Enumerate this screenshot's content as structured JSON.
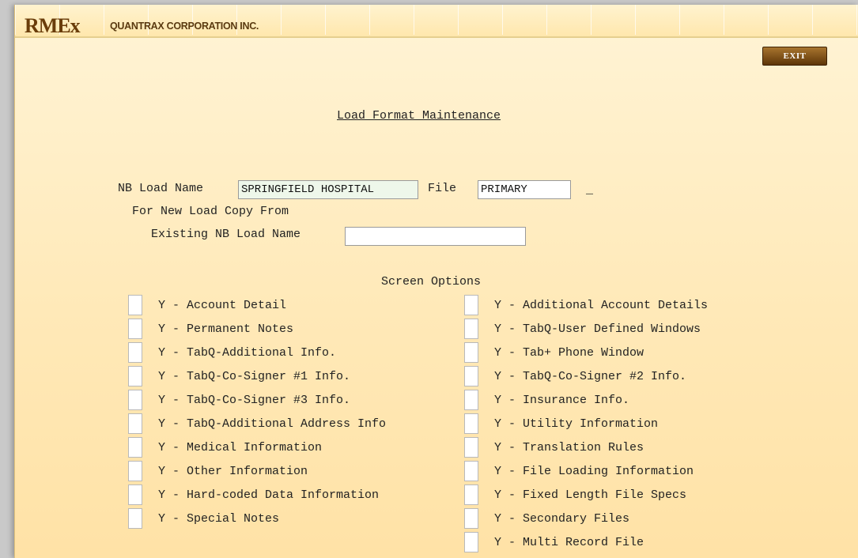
{
  "header": {
    "logo": "RMEx",
    "company": "QUANTRAX CORPORATION INC.",
    "exit_label": "EXIT"
  },
  "page_title": "Load Format Maintenance",
  "form": {
    "nb_load_name_label": "NB Load Name",
    "nb_load_name_value": "SPRINGFIELD HOSPITAL",
    "file_label": "File",
    "file_value": "PRIMARY",
    "cursor_char": "_",
    "copy_from_label": "For New Load Copy From",
    "existing_label": "Existing NB Load Name",
    "existing_value": ""
  },
  "screen_options": {
    "heading": "Screen Options",
    "left": [
      "Y - Account Detail",
      "Y - Permanent Notes",
      "Y - TabQ-Additional Info.",
      "Y - TabQ-Co-Signer #1 Info.",
      "Y - TabQ-Co-Signer #3 Info.",
      "Y - TabQ-Additional Address Info",
      "Y - Medical Information",
      "Y - Other Information",
      "Y - Hard-coded Data Information",
      "Y - Special Notes"
    ],
    "right": [
      "Y - Additional Account Details",
      "Y - TabQ-User Defined Windows",
      "Y - Tab+ Phone Window",
      "Y - TabQ-Co-Signer #2 Info.",
      "Y - Insurance Info.",
      "Y - Utility Information",
      "Y - Translation Rules",
      "Y - File Loading Information",
      "Y - Fixed Length File Specs",
      "Y - Secondary Files",
      "Y - Multi Record File"
    ]
  }
}
